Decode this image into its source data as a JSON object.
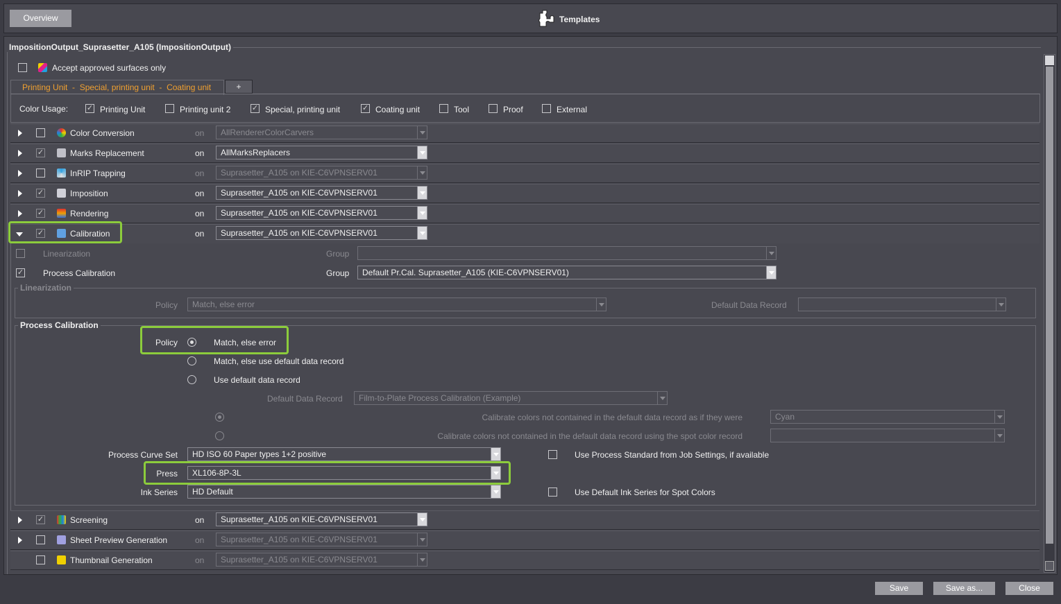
{
  "topbar": {
    "overview_label": "Overview",
    "title": "Templates",
    "title_icon": "puzzle-icon"
  },
  "panel": {
    "title": "ImpositionOutput_Suprasetter_A105 (ImpositionOutput)",
    "accept_label": "Accept approved surfaces only",
    "accept_checked": false
  },
  "tabs": {
    "active": "Printing Unit  -  Special, printing unit  -  Coating unit",
    "add": "+"
  },
  "color_usage": {
    "label": "Color Usage:",
    "items": [
      {
        "label": "Printing Unit",
        "checked": true
      },
      {
        "label": "Printing unit 2",
        "checked": false
      },
      {
        "label": "Special, printing unit",
        "checked": true
      },
      {
        "label": "Coating unit",
        "checked": true
      },
      {
        "label": "Tool",
        "checked": false
      },
      {
        "label": "Proof",
        "checked": false
      },
      {
        "label": "External",
        "checked": false
      }
    ]
  },
  "modules": [
    {
      "name": "Color Conversion",
      "checked": false,
      "enabled": false,
      "on": "on",
      "value": "AllRendererColorCarvers",
      "icon": "color-wheel-icon",
      "expanded": false
    },
    {
      "name": "Marks Replacement",
      "checked": true,
      "enabled": true,
      "on": "on",
      "value": "AllMarksReplacers",
      "icon": "marks-icon",
      "expanded": false
    },
    {
      "name": "InRIP Trapping",
      "checked": false,
      "enabled": false,
      "on": "on",
      "value": "Suprasetter_A105 on KIE-C6VPNSERV01",
      "icon": "trapping-icon",
      "expanded": false
    },
    {
      "name": "Imposition",
      "checked": true,
      "enabled": true,
      "on": "on",
      "value": "Suprasetter_A105 on KIE-C6VPNSERV01",
      "icon": "imposition-icon",
      "expanded": false
    },
    {
      "name": "Rendering",
      "checked": true,
      "enabled": true,
      "on": "on",
      "value": "Suprasetter_A105 on KIE-C6VPNSERV01",
      "icon": "rendering-icon",
      "expanded": false
    },
    {
      "name": "Calibration",
      "checked": true,
      "enabled": true,
      "on": "on",
      "value": "Suprasetter_A105 on KIE-C6VPNSERV01",
      "icon": "calibration-icon",
      "expanded": true
    },
    {
      "name": "Screening",
      "checked": true,
      "enabled": true,
      "on": "on",
      "value": "Suprasetter_A105 on KIE-C6VPNSERV01",
      "icon": "screening-icon",
      "expanded": false
    },
    {
      "name": "Sheet Preview Generation",
      "checked": false,
      "enabled": false,
      "on": "on",
      "value": "Suprasetter_A105 on KIE-C6VPNSERV01",
      "icon": "sheet-preview-icon",
      "expanded": false
    },
    {
      "name": "Thumbnail Generation",
      "checked": false,
      "enabled": false,
      "on": "on",
      "value": "Suprasetter_A105 on KIE-C6VPNSERV01",
      "icon": "thumbnail-icon",
      "expanded": false,
      "no_arrow": true
    }
  ],
  "calibration": {
    "linearization": {
      "label": "Linearization",
      "checked": false,
      "group_label": "Group",
      "group_value": ""
    },
    "process": {
      "label": "Process Calibration",
      "checked": true,
      "group_label": "Group",
      "group_value": "Default Pr.Cal. Suprasetter_A105 (KIE-C6VPNSERV01)"
    },
    "lin_section": {
      "title": "Linearization",
      "policy_label": "Policy",
      "policy_value": "Match, else error",
      "ddr_label": "Default Data Record",
      "ddr_value": ""
    },
    "pc_section": {
      "title": "Process Calibration",
      "policy_label": "Policy",
      "policy_options": [
        {
          "label": "Match, else error",
          "selected": true
        },
        {
          "label": "Match, else use default data record",
          "selected": false
        },
        {
          "label": "Use default data record",
          "selected": false
        }
      ],
      "ddr_label": "Default Data Record",
      "ddr_value": "Film-to-Plate Process Calibration (Example)",
      "calib_asif_label": "Calibrate colors not contained in the default data record as if they were",
      "calib_asif_value": "Cyan",
      "calib_asif_selected": true,
      "calib_spot_label": "Calibrate colors not contained in the default data record using the spot color record",
      "calib_spot_value": "",
      "calib_spot_selected": false,
      "curve_label": "Process Curve Set",
      "curve_value": "HD ISO 60 Paper types 1+2 positive",
      "press_label": "Press",
      "press_value": "XL106-8P-3L",
      "ink_label": "Ink Series",
      "ink_value": "HD Default",
      "use_std_label": "Use Process Standard from Job Settings, if available",
      "use_std_checked": false,
      "use_ink_label": "Use Default Ink Series for Spot Colors",
      "use_ink_checked": false
    }
  },
  "footer": {
    "save": "Save",
    "save_as": "Save as...",
    "close": "Close"
  },
  "colors": {
    "highlight": "#8ccc3c",
    "tab_text": "#f0a030",
    "background": "#484850"
  }
}
